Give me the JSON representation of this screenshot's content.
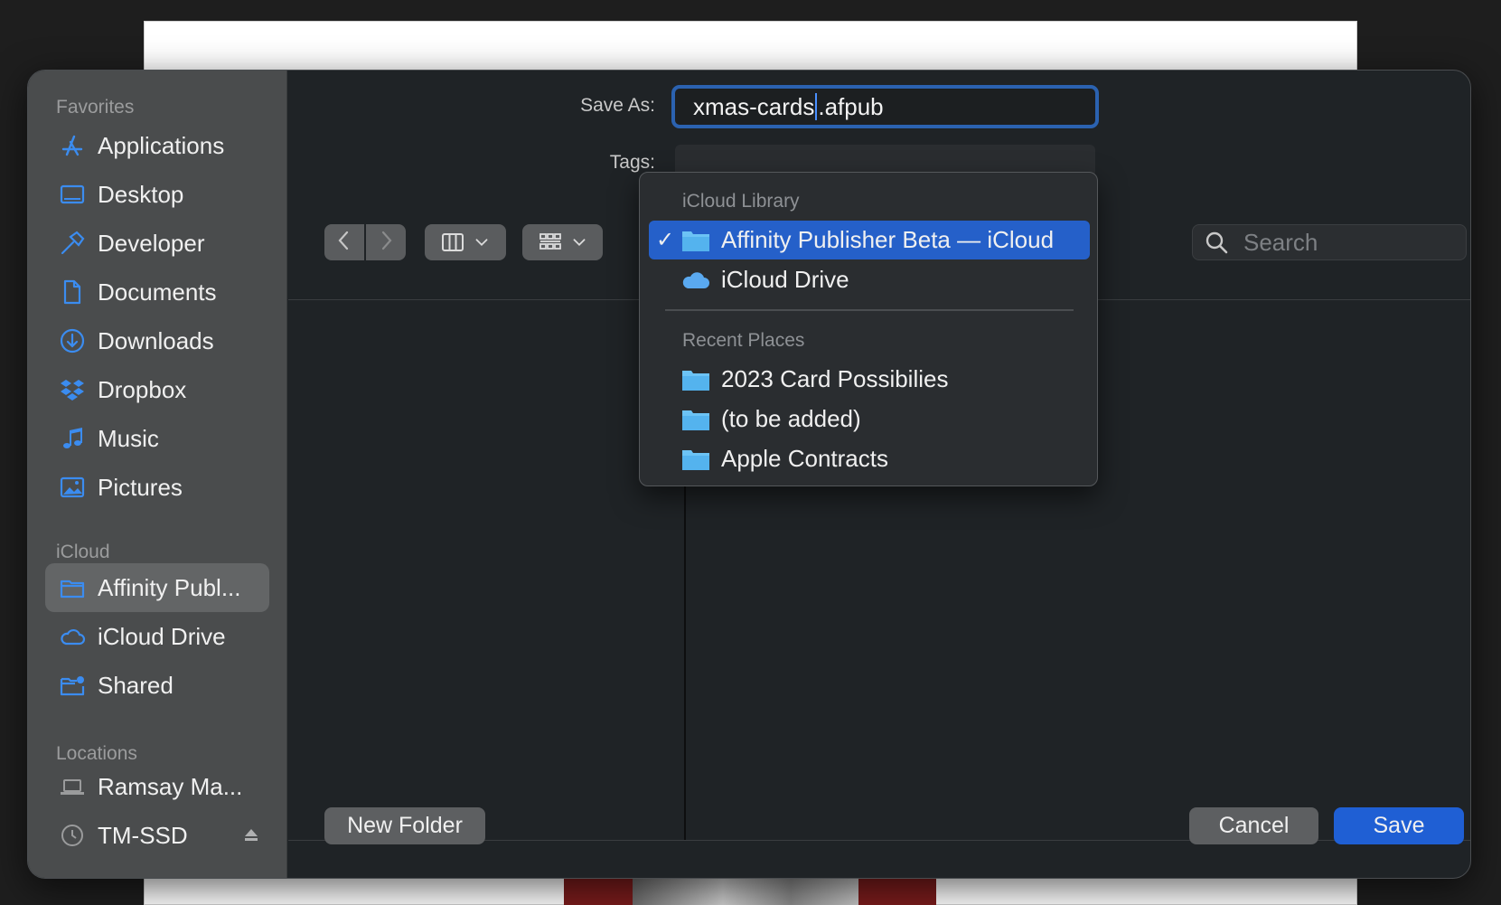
{
  "sidebar": {
    "favorites_header": "Favorites",
    "favorites": [
      {
        "label": "Applications",
        "icon": "applications-icon"
      },
      {
        "label": "Desktop",
        "icon": "desktop-icon"
      },
      {
        "label": "Developer",
        "icon": "hammer-icon"
      },
      {
        "label": "Documents",
        "icon": "document-icon"
      },
      {
        "label": "Downloads",
        "icon": "download-icon"
      },
      {
        "label": "Dropbox",
        "icon": "dropbox-icon"
      },
      {
        "label": "Music",
        "icon": "music-note-icon"
      },
      {
        "label": "Pictures",
        "icon": "pictures-icon"
      }
    ],
    "icloud_header": "iCloud",
    "icloud": [
      {
        "label": "Affinity Publ...",
        "icon": "folder-icon",
        "selected": true
      },
      {
        "label": "iCloud Drive",
        "icon": "cloud-icon"
      },
      {
        "label": "Shared",
        "icon": "shared-folder-icon"
      }
    ],
    "locations_header": "Locations",
    "locations": [
      {
        "label": "Ramsay Ma...",
        "icon": "laptop-icon"
      },
      {
        "label": "TM-SSD",
        "icon": "time-machine-icon"
      }
    ]
  },
  "form": {
    "save_as_label": "Save As:",
    "filename_before_caret": "xmas-cards",
    "filename_after_caret": ".afpub",
    "tags_label": "Tags:"
  },
  "toolbar": {
    "search_placeholder": "Search"
  },
  "popup": {
    "icloud_header": "iCloud Library",
    "icloud_items": [
      {
        "label": "Affinity Publisher Beta — iCloud",
        "checked": true
      },
      {
        "label": "iCloud Drive"
      }
    ],
    "recent_header": "Recent Places",
    "recent_items": [
      {
        "label": "2023 Card Possibilies"
      },
      {
        "label": "(to be added)"
      },
      {
        "label": "Apple Contracts"
      }
    ]
  },
  "buttons": {
    "new_folder": "New Folder",
    "cancel": "Cancel",
    "save": "Save"
  },
  "colors": {
    "accent": "#2560c9",
    "save_button": "#1f5fd4",
    "sidebar_icon": "#3b8cf0"
  }
}
